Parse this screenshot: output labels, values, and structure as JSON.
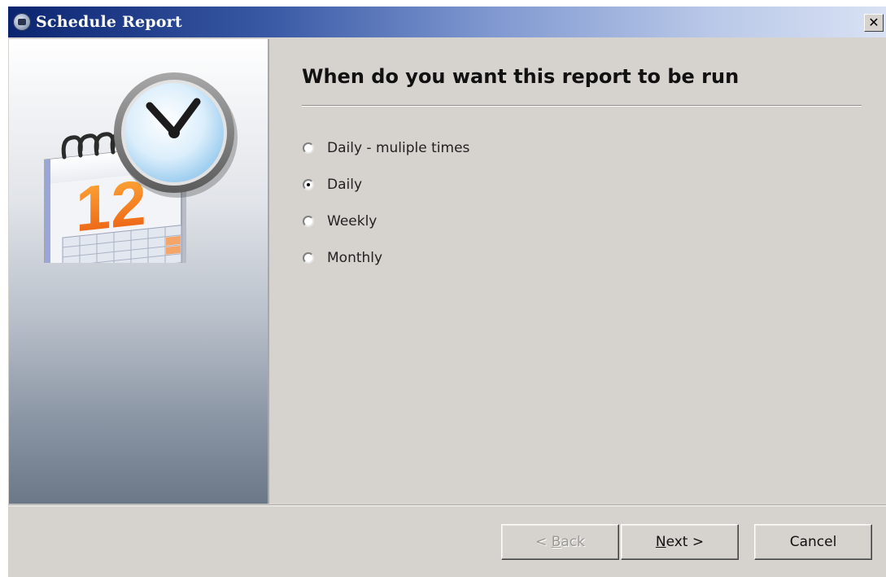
{
  "window": {
    "title": "Schedule Report",
    "close_glyph": "✕"
  },
  "icons": {
    "app": "report-clock-icon",
    "illustration": "calendar-clock-icon"
  },
  "illustration": {
    "calendar_number": "12"
  },
  "page": {
    "heading": "When do you want this report to be run",
    "options": [
      {
        "label": "Daily - muliple times",
        "checked": false
      },
      {
        "label": "Daily",
        "checked": true
      },
      {
        "label": "Weekly",
        "checked": false
      },
      {
        "label": "Monthly",
        "checked": false
      }
    ]
  },
  "buttons": {
    "back": {
      "prefix": "< ",
      "mnemonic": "B",
      "rest": "ack",
      "enabled": false
    },
    "next": {
      "mnemonic": "N",
      "rest": "ext >",
      "enabled": true
    },
    "cancel": {
      "label": "Cancel",
      "enabled": true
    }
  },
  "colors": {
    "titlebar_start": "#0b2470",
    "titlebar_end": "#d9e2f4",
    "dialog_face": "#d6d3ce"
  }
}
